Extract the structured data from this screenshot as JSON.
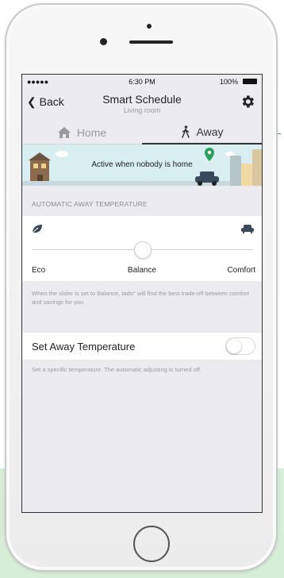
{
  "status_bar": {
    "signal": "●●●●● ",
    "time": "6:30 PM",
    "battery": "100%"
  },
  "nav": {
    "back_label": "Back",
    "title": "Smart Schedule",
    "subtitle": "Living room"
  },
  "tabs": [
    {
      "label": "Home",
      "icon": "house-icon",
      "selected": false
    },
    {
      "label": "Away",
      "icon": "walking-person-icon",
      "selected": true
    }
  ],
  "banner": {
    "text": "Active when nobody is home"
  },
  "away_temperature": {
    "section_header": "AUTOMATIC AWAY TEMPERATURE",
    "left_icon": "leaf-icon",
    "right_icon": "sofa-icon",
    "slider_position": 0.5,
    "labels": {
      "eco": "Eco",
      "balance": "Balance",
      "comfort": "Comfort"
    },
    "help_text": "When the slider is set to Balance, tado° will find the best trade-off between comfort and savings for you"
  },
  "set_away": {
    "label": "Set Away Temperature",
    "toggle_on": false,
    "help_text": "Set a specific temperature. The automatic adjusting is turned off."
  },
  "colors": {
    "accent_green": "#2e9e5b",
    "screen_bg": "#ececf0",
    "banner_bg": "#d8eef1",
    "muted_text": "#9b9b9b"
  }
}
